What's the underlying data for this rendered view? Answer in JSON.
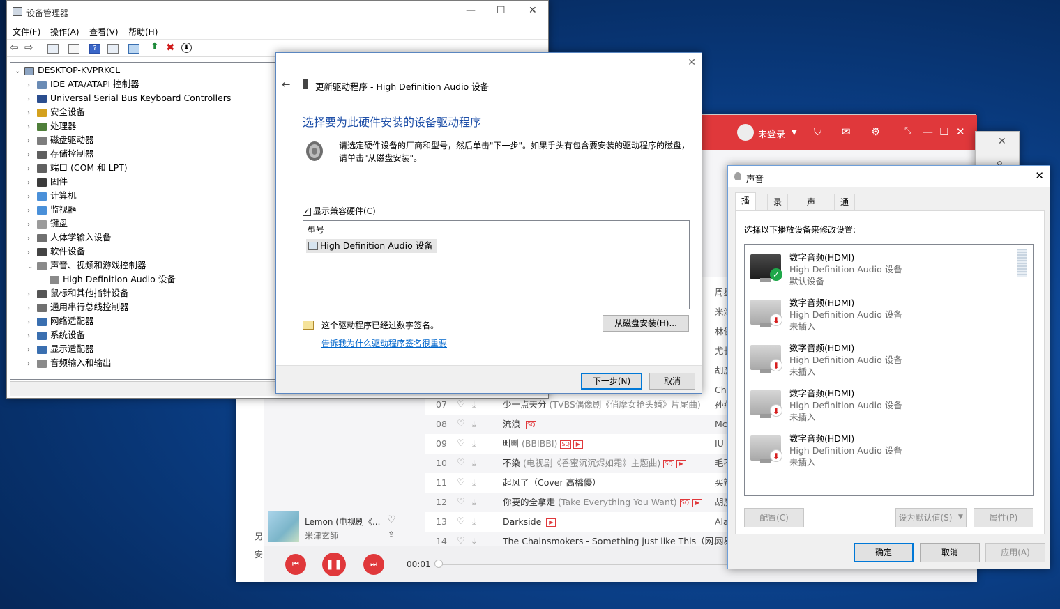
{
  "music": {
    "login_label": "未登录",
    "songs": [
      {
        "num": "07",
        "title": "少一点天分",
        "sub": "(TVBS偶像剧《俏摩女抢头婚》片尾曲)",
        "sq": "",
        "mv": "",
        "artist": "孙燕"
      },
      {
        "num": "08",
        "title": "流浪",
        "sub": "",
        "sq": "SQ",
        "mv": "",
        "artist": "Mc"
      },
      {
        "num": "09",
        "title": "삐삐",
        "sub": "(BBIBBI)",
        "sq": "SQ",
        "mv": "▶",
        "artist": "IU"
      },
      {
        "num": "10",
        "title": "不染",
        "sub": "(电视剧《香蜜沉沉烬如霜》主题曲)",
        "sq": "SQ",
        "mv": "▶",
        "artist": "毛不"
      },
      {
        "num": "11",
        "title": "起风了（Cover 高橋優）",
        "sub": "",
        "sq": "",
        "mv": "",
        "artist": "买辣"
      },
      {
        "num": "12",
        "title": "你要的全拿走",
        "sub": "(Take Everything You Want)",
        "sq": "SQ",
        "mv": "▶",
        "artist": "胡彦"
      },
      {
        "num": "13",
        "title": "Darkside",
        "sub": "",
        "sq": "",
        "mv": "▶",
        "artist": "Ala"
      },
      {
        "num": "14",
        "title": "The Chainsmokers - Something just like This（网...",
        "sub": "",
        "sq": "",
        "mv": "",
        "artist": "网易"
      }
    ],
    "partial_artists": [
      "周星",
      "米津",
      "林俊",
      "尤长",
      "胡彦",
      "Ch"
    ],
    "now_playing_title": "Lemon (电视剧《...",
    "now_playing_artist": "米津玄師",
    "time": "00:01",
    "side_labels": [
      "另",
      "安"
    ]
  },
  "device_manager": {
    "title": "设备管理器",
    "menus": [
      "文件(F)",
      "操作(A)",
      "查看(V)",
      "帮助(H)"
    ],
    "root": "DESKTOP-KVPRKCL",
    "nodes": [
      {
        "label": "IDE ATA/ATAPI 控制器",
        "expanded": false
      },
      {
        "label": "Universal Serial Bus Keyboard Controllers",
        "expanded": false
      },
      {
        "label": "安全设备",
        "expanded": false
      },
      {
        "label": "处理器",
        "expanded": false
      },
      {
        "label": "磁盘驱动器",
        "expanded": false
      },
      {
        "label": "存储控制器",
        "expanded": false
      },
      {
        "label": "端口 (COM 和 LPT)",
        "expanded": false
      },
      {
        "label": "固件",
        "expanded": false
      },
      {
        "label": "计算机",
        "expanded": false
      },
      {
        "label": "监视器",
        "expanded": false
      },
      {
        "label": "键盘",
        "expanded": false
      },
      {
        "label": "人体学输入设备",
        "expanded": false
      },
      {
        "label": "软件设备",
        "expanded": false
      },
      {
        "label": "声音、视频和游戏控制器",
        "expanded": true
      },
      {
        "label": "High Definition Audio 设备",
        "child": true
      },
      {
        "label": "鼠标和其他指针设备",
        "expanded": false
      },
      {
        "label": "通用串行总线控制器",
        "expanded": false
      },
      {
        "label": "网络适配器",
        "expanded": false
      },
      {
        "label": "系统设备",
        "expanded": false
      },
      {
        "label": "显示适配器",
        "expanded": false
      },
      {
        "label": "音频输入和输出",
        "expanded": false
      }
    ]
  },
  "driver_dialog": {
    "header": "更新驱动程序 - High Definition Audio 设备",
    "heading": "选择要为此硬件安装的设备驱动程序",
    "desc_line1": "请选定硬件设备的厂商和型号，然后单击\"下一步\"。如果手头有包含要安装的驱动程序的磁盘，",
    "desc_line2": "请单击\"从磁盘安装\"。",
    "show_compatible": "显示兼容硬件(C)",
    "show_compatible_checked": "✓",
    "list_header": "型号",
    "list_item": "High Definition Audio 设备",
    "signed_text": "这个驱动程序已经过数字签名。",
    "signed_link": "告诉我为什么驱动程序签名很重要",
    "have_disk": "从磁盘安装(H)...",
    "next": "下一步(N)",
    "cancel": "取消"
  },
  "sound_dialog": {
    "title": "声音",
    "tabs": [
      "播放",
      "录制",
      "声音",
      "通信"
    ],
    "instruction": "选择以下播放设备来修改设置:",
    "devices": [
      {
        "name": "数字音频(HDMI)",
        "desc": "High Definition Audio 设备",
        "status": "默认设备",
        "default": true
      },
      {
        "name": "数字音频(HDMI)",
        "desc": "High Definition Audio 设备",
        "status": "未插入",
        "default": false
      },
      {
        "name": "数字音频(HDMI)",
        "desc": "High Definition Audio 设备",
        "status": "未插入",
        "default": false
      },
      {
        "name": "数字音频(HDMI)",
        "desc": "High Definition Audio 设备",
        "status": "未插入",
        "default": false
      },
      {
        "name": "数字音频(HDMI)",
        "desc": "High Definition Audio 设备",
        "status": "未插入",
        "default": false
      }
    ],
    "configure": "配置(C)",
    "set_default": "设为默认值(S)",
    "properties": "属性(P)",
    "ok": "确定",
    "cancel": "取消",
    "apply": "应用(A)"
  },
  "colors": {
    "accent_red": "#e0383b",
    "link_blue": "#0066cc",
    "heading_blue": "#1e4fa8",
    "ok_green": "#1fa84a",
    "unplugged_red": "#d71f1f"
  }
}
